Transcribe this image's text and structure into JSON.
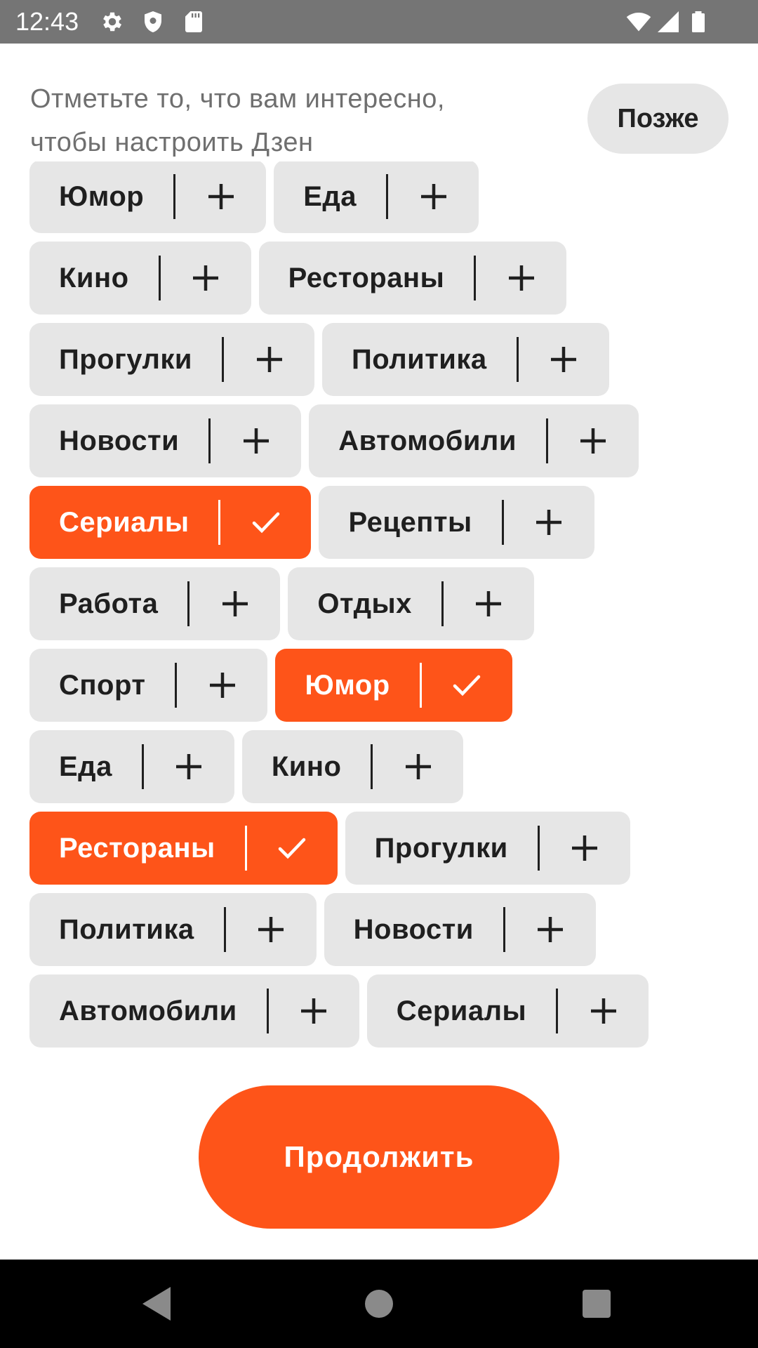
{
  "status_bar": {
    "time": "12:43",
    "left_icons": [
      "gear-icon",
      "shield-icon",
      "sd-card-icon"
    ],
    "right_icons": [
      "wifi-icon",
      "cell-signal-icon",
      "battery-icon"
    ]
  },
  "header": {
    "prompt": "Отметьте то, что вам интересно, чтобы настроить Дзен",
    "later_label": "Позже"
  },
  "colors": {
    "accent": "#fe5419",
    "chip_bg": "#e6e6e6",
    "text": "#1f1f1f"
  },
  "tag_rows": [
    [
      {
        "label": "Юмор",
        "selected": false
      },
      {
        "label": "Еда",
        "selected": false
      }
    ],
    [
      {
        "label": "Кино",
        "selected": false
      },
      {
        "label": "Рестораны",
        "selected": false
      }
    ],
    [
      {
        "label": "Прогулки",
        "selected": false
      },
      {
        "label": "Политика",
        "selected": false
      }
    ],
    [
      {
        "label": "Новости",
        "selected": false
      },
      {
        "label": "Автомобили",
        "selected": false
      }
    ],
    [
      {
        "label": "Сериалы",
        "selected": true
      },
      {
        "label": "Рецепты",
        "selected": false
      }
    ],
    [
      {
        "label": "Работа",
        "selected": false
      },
      {
        "label": "Отдых",
        "selected": false
      }
    ],
    [
      {
        "label": "Спорт",
        "selected": false
      },
      {
        "label": "Юмор",
        "selected": true
      }
    ],
    [
      {
        "label": "Еда",
        "selected": false
      },
      {
        "label": "Кино",
        "selected": false
      }
    ],
    [
      {
        "label": "Рестораны",
        "selected": true
      },
      {
        "label": "Прогулки",
        "selected": false
      }
    ],
    [
      {
        "label": "Политика",
        "selected": false
      },
      {
        "label": "Новости",
        "selected": false
      }
    ],
    [
      {
        "label": "Автомобили",
        "selected": false
      },
      {
        "label": "Сериалы",
        "selected": false
      }
    ]
  ],
  "continue_label": "Продолжить",
  "nav_bar": {
    "icons": [
      "back-triangle-icon",
      "home-circle-icon",
      "recents-square-icon"
    ]
  }
}
